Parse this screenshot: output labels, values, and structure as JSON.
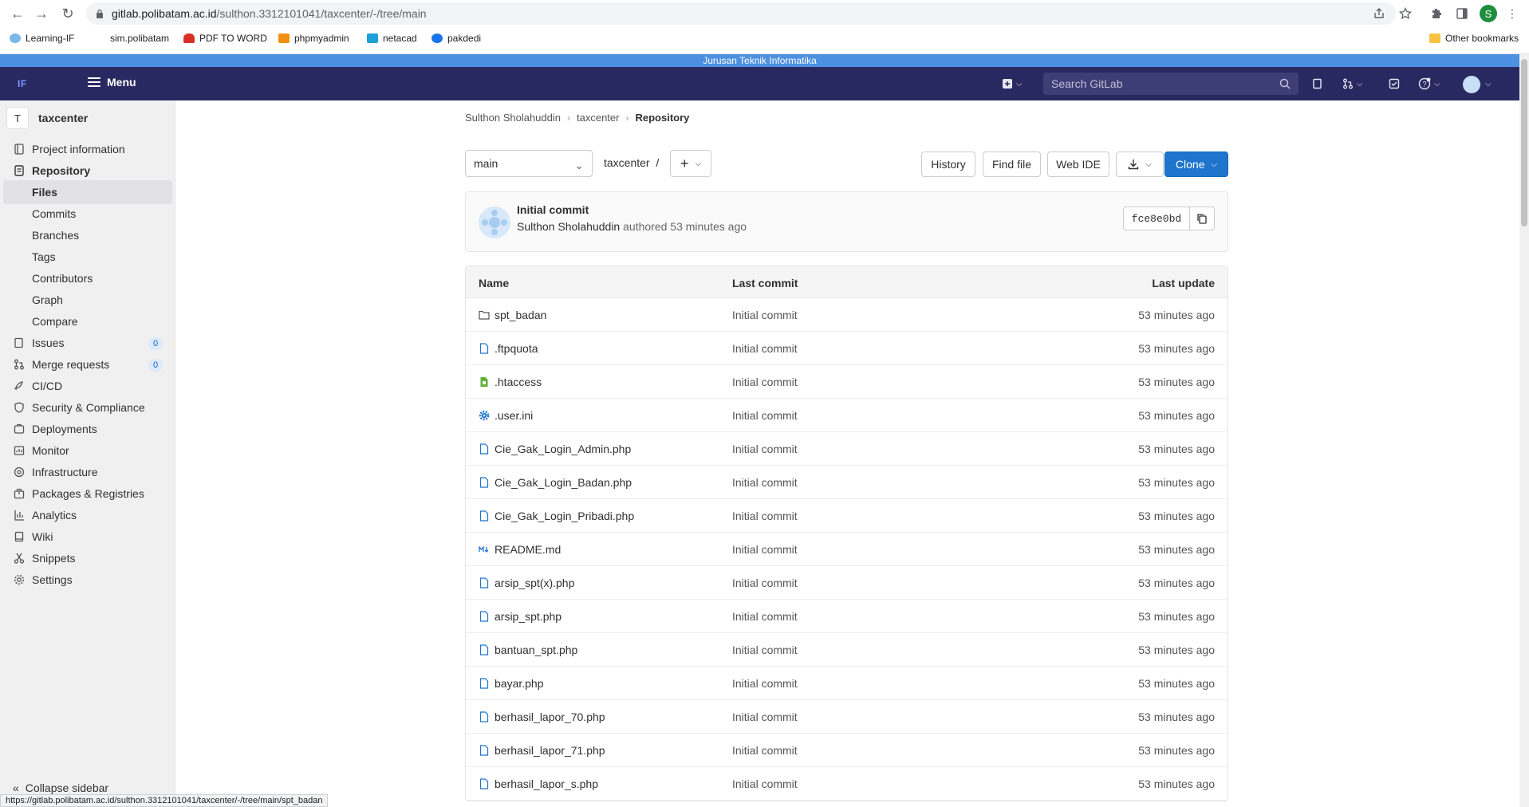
{
  "browser": {
    "url_host": "gitlab.polibatam.ac.id",
    "url_path": "/sulthon.3312101041/taxcenter/-/tree/main",
    "profile_initial": "S",
    "bookmarks": [
      "Learning-IF",
      "sim.polibatam",
      "PDF TO WORD",
      "phpmyadmin",
      "netacad",
      "pakdedi"
    ],
    "other_bookmarks": "Other bookmarks",
    "status_url": "https://gitlab.polibatam.ac.id/sulthon.3312101041/taxcenter/-/tree/main/spt_badan"
  },
  "env_banner": "Jurusan Teknik Informatika",
  "header": {
    "logo_text": "IF",
    "menu_label": "Menu",
    "search_placeholder": "Search GitLab"
  },
  "sidebar": {
    "project_initial": "T",
    "project_name": "taxcenter",
    "items": [
      {
        "label": "Project information",
        "icon": "info-icon"
      },
      {
        "label": "Repository",
        "icon": "doc-icon"
      },
      {
        "label": "Files",
        "sub": true,
        "active": true
      },
      {
        "label": "Commits",
        "sub": true
      },
      {
        "label": "Branches",
        "sub": true
      },
      {
        "label": "Tags",
        "sub": true
      },
      {
        "label": "Contributors",
        "sub": true
      },
      {
        "label": "Graph",
        "sub": true
      },
      {
        "label": "Compare",
        "sub": true
      },
      {
        "label": "Issues",
        "icon": "issues-icon",
        "count": "0"
      },
      {
        "label": "Merge requests",
        "icon": "merge-icon",
        "count": "0"
      },
      {
        "label": "CI/CD",
        "icon": "rocket-icon"
      },
      {
        "label": "Security & Compliance",
        "icon": "shield-icon"
      },
      {
        "label": "Deployments",
        "icon": "deploy-icon"
      },
      {
        "label": "Monitor",
        "icon": "monitor-icon"
      },
      {
        "label": "Infrastructure",
        "icon": "cloud-icon"
      },
      {
        "label": "Packages & Registries",
        "icon": "package-icon"
      },
      {
        "label": "Analytics",
        "icon": "chart-icon"
      },
      {
        "label": "Wiki",
        "icon": "book-icon"
      },
      {
        "label": "Snippets",
        "icon": "scissors-icon"
      },
      {
        "label": "Settings",
        "icon": "gear-icon"
      }
    ],
    "collapse_label": "Collapse sidebar"
  },
  "breadcrumb": [
    "Sulthon Sholahuddin",
    "taxcenter",
    "Repository"
  ],
  "toolbar": {
    "branch": "main",
    "path": "taxcenter",
    "path_sep": "/",
    "history": "History",
    "find_file": "Find file",
    "web_ide": "Web IDE",
    "clone": "Clone"
  },
  "commit": {
    "title": "Initial commit",
    "author": "Sulthon Sholahuddin",
    "authored_text": "authored 53 minutes ago",
    "sha": "fce8e0bd"
  },
  "tree": {
    "headers": {
      "name": "Name",
      "last_commit": "Last commit",
      "last_update": "Last update"
    },
    "rows": [
      {
        "name": "spt_badan",
        "type": "folder",
        "commit": "Initial commit",
        "updated": "53 minutes ago"
      },
      {
        "name": ".ftpquota",
        "type": "file",
        "commit": "Initial commit",
        "updated": "53 minutes ago"
      },
      {
        "name": ".htaccess",
        "type": "config",
        "commit": "Initial commit",
        "updated": "53 minutes ago"
      },
      {
        "name": ".user.ini",
        "type": "settings",
        "commit": "Initial commit",
        "updated": "53 minutes ago"
      },
      {
        "name": "Cie_Gak_Login_Admin.php",
        "type": "file",
        "commit": "Initial commit",
        "updated": "53 minutes ago"
      },
      {
        "name": "Cie_Gak_Login_Badan.php",
        "type": "file",
        "commit": "Initial commit",
        "updated": "53 minutes ago"
      },
      {
        "name": "Cie_Gak_Login_Pribadi.php",
        "type": "file",
        "commit": "Initial commit",
        "updated": "53 minutes ago"
      },
      {
        "name": "README.md",
        "type": "markdown",
        "commit": "Initial commit",
        "updated": "53 minutes ago"
      },
      {
        "name": "arsip_spt(x).php",
        "type": "file",
        "commit": "Initial commit",
        "updated": "53 minutes ago"
      },
      {
        "name": "arsip_spt.php",
        "type": "file",
        "commit": "Initial commit",
        "updated": "53 minutes ago"
      },
      {
        "name": "bantuan_spt.php",
        "type": "file",
        "commit": "Initial commit",
        "updated": "53 minutes ago"
      },
      {
        "name": "bayar.php",
        "type": "file",
        "commit": "Initial commit",
        "updated": "53 minutes ago"
      },
      {
        "name": "berhasil_lapor_70.php",
        "type": "file",
        "commit": "Initial commit",
        "updated": "53 minutes ago"
      },
      {
        "name": "berhasil_lapor_71.php",
        "type": "file",
        "commit": "Initial commit",
        "updated": "53 minutes ago"
      },
      {
        "name": "berhasil_lapor_s.php",
        "type": "file",
        "commit": "Initial commit",
        "updated": "53 minutes ago"
      }
    ]
  }
}
